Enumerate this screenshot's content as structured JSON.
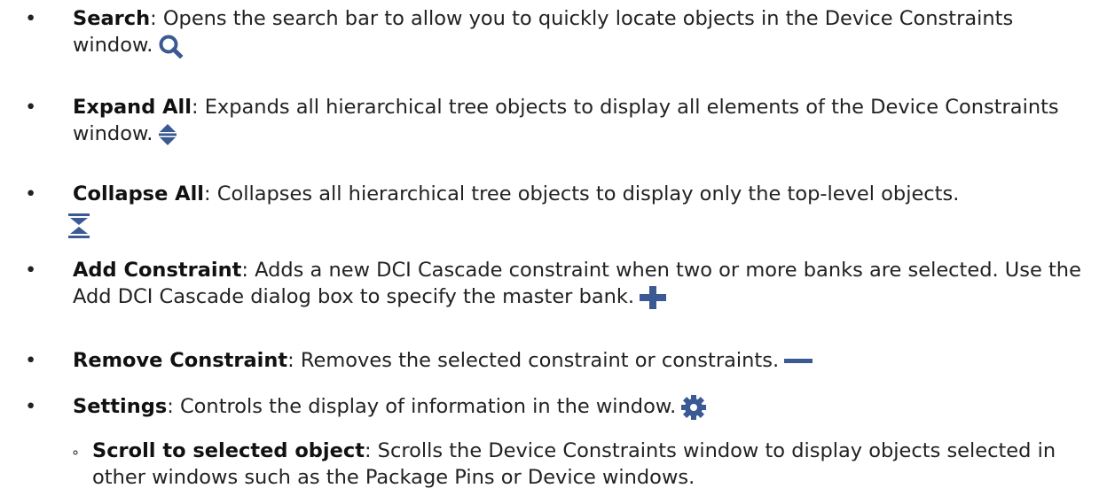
{
  "accent_color": "#3b5a94",
  "items": [
    {
      "term": "Search",
      "desc": ": Opens the search bar to allow you to quickly locate objects in the Device Constraints window.",
      "icon": "search-icon"
    },
    {
      "term": "Expand All",
      "desc": ": Expands all hierarchical tree objects to display all elements of the Device Constraints window.",
      "icon": "expand-all-icon"
    },
    {
      "term": "Collapse All",
      "desc": ": Collapses all hierarchical tree objects to display only the top-level objects.",
      "icon": "collapse-all-icon"
    },
    {
      "term": "Add Constraint",
      "desc": ": Adds a new DCI Cascade constraint when two or more banks are selected. Use the Add DCI Cascade dialog box to specify the master bank.",
      "icon": "plus-icon"
    },
    {
      "term": "Remove Constraint",
      "desc": ": Removes the selected constraint or constraints.",
      "icon": "minus-icon"
    },
    {
      "term": "Settings",
      "desc": ": Controls the display of information in the window.",
      "icon": "gear-icon"
    }
  ],
  "subitems": [
    {
      "term": "Scroll to selected object",
      "desc": ": Scrolls the Device Constraints window to display objects selected in other windows such as the Package Pins or Device windows."
    }
  ],
  "bullet_char": "•",
  "sub_bullet_char": "∘"
}
